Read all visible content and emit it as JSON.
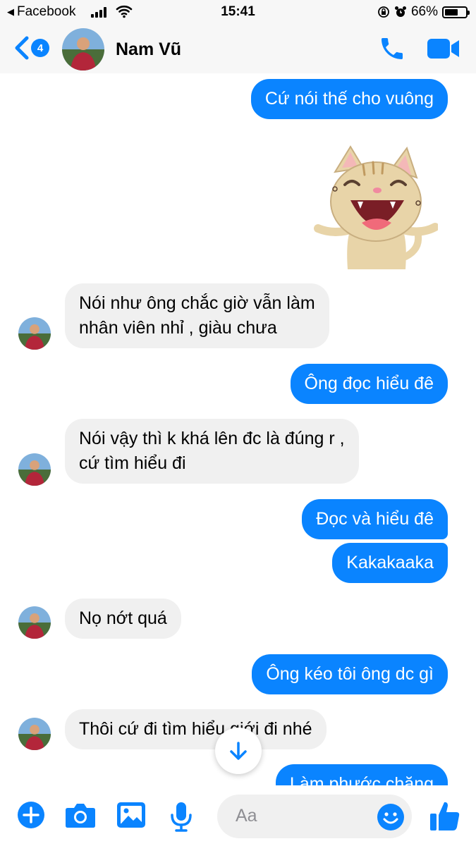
{
  "status_bar": {
    "back_app": "Facebook",
    "time": "15:41",
    "battery": "66%",
    "battery_level": 0.66
  },
  "header": {
    "unread_count": "4",
    "contact_name": "Nam Vũ"
  },
  "messages": [
    {
      "side": "out",
      "text": "Cứ nói thế cho vuông"
    },
    {
      "side": "out",
      "type": "sticker",
      "sticker": "laughing-cat-sticker"
    },
    {
      "side": "in",
      "lines": [
        "Nói như ông chắc giờ vẫn làm",
        "nhân viên nhỉ , giàu chưa"
      ]
    },
    {
      "side": "out",
      "text": "Ông đọc hiểu đê"
    },
    {
      "side": "in",
      "lines": [
        "Nói vậy thì k khá lên đc là đúng r ,",
        "cứ tìm hiểu đi"
      ]
    },
    {
      "side": "out",
      "text": "Đọc và hiểu đê"
    },
    {
      "side": "out",
      "text": "Kakakaaka"
    },
    {
      "side": "in",
      "text": "Nọ nớt quá"
    },
    {
      "side": "out",
      "text": "Ông kéo tôi ông dc gì"
    },
    {
      "side": "in",
      "text": "Thôi cứ đi tìm hiểu giới đi nhé"
    },
    {
      "side": "out",
      "text": "Làm phước chăng"
    }
  ],
  "composer": {
    "placeholder": "Aa",
    "icons": [
      "plus-icon",
      "camera-icon",
      "photo-icon",
      "microphone-icon",
      "emoji-icon",
      "thumbs-up-icon"
    ]
  },
  "colors": {
    "accent": "#0a84ff",
    "incoming_bubble": "#f0f0f0",
    "bar_background": "#f7f7f7"
  }
}
